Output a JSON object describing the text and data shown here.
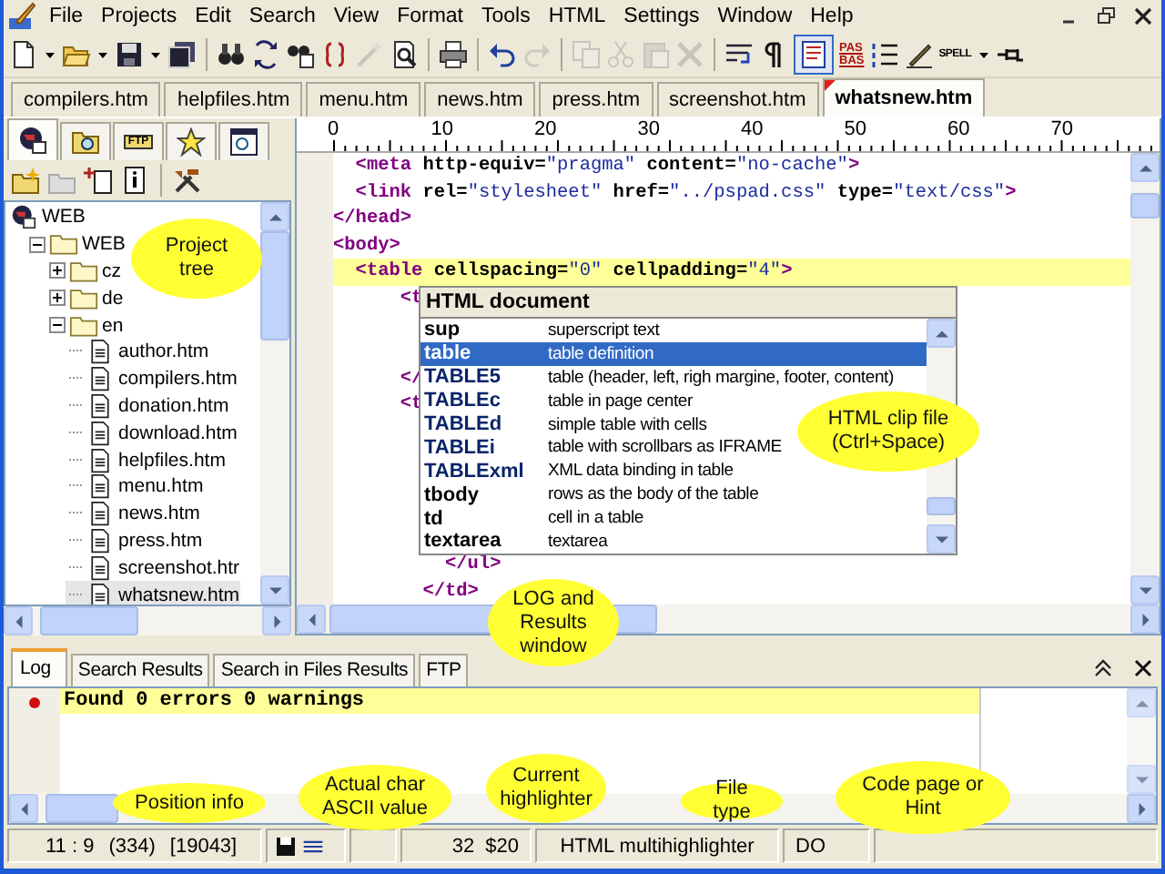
{
  "menu": [
    "File",
    "Projects",
    "Edit",
    "Search",
    "View",
    "Format",
    "Tools",
    "HTML",
    "Settings",
    "Window",
    "Help"
  ],
  "toolbar": [
    {
      "kind": "new",
      "disabled": false
    },
    {
      "kind": "dropdown",
      "disabled": false
    },
    {
      "kind": "open",
      "disabled": false
    },
    {
      "kind": "dropdown",
      "disabled": false
    },
    {
      "kind": "save",
      "disabled": false
    },
    {
      "kind": "dropdown",
      "disabled": false
    },
    {
      "kind": "saveall",
      "disabled": false
    },
    {
      "kind": "separator"
    },
    {
      "kind": "find",
      "disabled": false
    },
    {
      "kind": "replace",
      "disabled": false
    },
    {
      "kind": "findfiles",
      "disabled": false
    },
    {
      "kind": "braces",
      "disabled": false
    },
    {
      "kind": "magic",
      "disabled": true
    },
    {
      "kind": "preview",
      "disabled": false
    },
    {
      "kind": "separator"
    },
    {
      "kind": "print",
      "disabled": false
    },
    {
      "kind": "separator"
    },
    {
      "kind": "undo",
      "disabled": false
    },
    {
      "kind": "redo",
      "disabled": true
    },
    {
      "kind": "separator"
    },
    {
      "kind": "copy",
      "disabled": true
    },
    {
      "kind": "cut",
      "disabled": true
    },
    {
      "kind": "paste",
      "disabled": true
    },
    {
      "kind": "delete",
      "disabled": true
    },
    {
      "kind": "separator"
    },
    {
      "kind": "wrap",
      "disabled": false
    },
    {
      "kind": "pilcrow",
      "disabled": false
    },
    {
      "kind": "toggle",
      "on": true
    },
    {
      "kind": "case",
      "lines": [
        "PAS",
        "BAS"
      ]
    },
    {
      "kind": "list",
      "disabled": false
    },
    {
      "kind": "pencil",
      "disabled": false
    },
    {
      "kind": "spell",
      "text": "SPELL"
    },
    {
      "kind": "dropdown",
      "disabled": false
    },
    {
      "kind": "pin",
      "disabled": false
    }
  ],
  "file_tabs": [
    {
      "label": "compilers.htm",
      "selected": false,
      "modified": false
    },
    {
      "label": "helpfiles.htm",
      "selected": false,
      "modified": false
    },
    {
      "label": "menu.htm",
      "selected": false,
      "modified": false
    },
    {
      "label": "news.htm",
      "selected": false,
      "modified": false
    },
    {
      "label": "press.htm",
      "selected": false,
      "modified": false
    },
    {
      "label": "screenshot.htm",
      "selected": false,
      "modified": false
    },
    {
      "label": "whatsnew.htm",
      "selected": true,
      "modified": true
    }
  ],
  "side_tabs": [
    {
      "kind": "project",
      "selected": true
    },
    {
      "kind": "find",
      "selected": false
    },
    {
      "kind": "ftp",
      "label": "FTP",
      "selected": false
    },
    {
      "kind": "favorites",
      "selected": false
    },
    {
      "kind": "search",
      "selected": false
    }
  ],
  "tree": [
    {
      "label": "WEB",
      "kind": "root",
      "children": [
        {
          "label": "WEB",
          "kind": "folder",
          "expanded": true,
          "children": [
            {
              "label": "cz",
              "kind": "folder",
              "expanded": false
            },
            {
              "label": "de",
              "kind": "folder",
              "expanded": false
            },
            {
              "label": "en",
              "kind": "folder",
              "expanded": true,
              "children": [
                {
                  "label": "author.htm",
                  "kind": "file",
                  "selected": false
                },
                {
                  "label": "compilers.htm",
                  "kind": "file",
                  "selected": false
                },
                {
                  "label": "donation.htm",
                  "kind": "file",
                  "selected": false
                },
                {
                  "label": "download.htm",
                  "kind": "file",
                  "selected": false
                },
                {
                  "label": "helpfiles.htm",
                  "kind": "file",
                  "selected": false
                },
                {
                  "label": "menu.htm",
                  "kind": "file",
                  "selected": false
                },
                {
                  "label": "news.htm",
                  "kind": "file",
                  "selected": false
                },
                {
                  "label": "press.htm",
                  "kind": "file",
                  "selected": false
                },
                {
                  "label": "screenshot.htr",
                  "kind": "file",
                  "selected": false
                },
                {
                  "label": "whatsnew.htm",
                  "kind": "file",
                  "selected": true
                }
              ]
            }
          ]
        }
      ]
    }
  ],
  "ruler": [
    "0",
    "10",
    "20",
    "30",
    "40",
    "50",
    "60",
    "70"
  ],
  "editor": {
    "lines": [
      {
        "kind": "code",
        "highlighted": false,
        "segs": [
          {
            "kind": "tag",
            "t": "  <meta"
          },
          {
            "kind": "attr",
            "t": " http-equiv="
          },
          {
            "kind": "val",
            "t": "\"pragma\""
          },
          {
            "kind": "attr",
            "t": " content="
          },
          {
            "kind": "val",
            "t": "\"no-cache\""
          },
          {
            "kind": "tag",
            "t": ">"
          }
        ]
      },
      {
        "kind": "code",
        "highlighted": false,
        "segs": [
          {
            "kind": "tag",
            "t": "  <link"
          },
          {
            "kind": "attr",
            "t": " rel="
          },
          {
            "kind": "val",
            "t": "\"stylesheet\""
          },
          {
            "kind": "attr",
            "t": " href="
          },
          {
            "kind": "val",
            "t": "\"../pspad.css\""
          },
          {
            "kind": "attr",
            "t": " type="
          },
          {
            "kind": "val",
            "t": "\"text/css\""
          },
          {
            "kind": "tag",
            "t": ">"
          }
        ]
      },
      {
        "kind": "code",
        "highlighted": false,
        "segs": [
          {
            "kind": "tag",
            "t": "</head>"
          }
        ]
      },
      {
        "kind": "code",
        "highlighted": false,
        "segs": [
          {
            "kind": "tag",
            "t": "<body>"
          }
        ]
      },
      {
        "kind": "code",
        "highlighted": true,
        "segs": [
          {
            "kind": "tag",
            "t": "  <table"
          },
          {
            "kind": "attr",
            "t": " cellspacing="
          },
          {
            "kind": "val",
            "t": "\"0\""
          },
          {
            "kind": "attr",
            "t": " cellpadding="
          },
          {
            "kind": "val",
            "t": "\"4\""
          },
          {
            "kind": "tag",
            "t": ">"
          }
        ]
      },
      {
        "kind": "code",
        "highlighted": false,
        "segs": [
          {
            "kind": "tag",
            "t": "      <t"
          }
        ]
      },
      {
        "kind": "covered"
      },
      {
        "kind": "covered"
      },
      {
        "kind": "code",
        "highlighted": false,
        "segs": [
          {
            "kind": "tag",
            "t": "      </"
          }
        ]
      },
      {
        "kind": "code",
        "highlighted": false,
        "segs": [
          {
            "kind": "tag",
            "t": "      <t"
          }
        ]
      },
      {
        "kind": "covered"
      },
      {
        "kind": "covered"
      },
      {
        "kind": "covered"
      },
      {
        "kind": "covered"
      },
      {
        "kind": "covered"
      },
      {
        "kind": "code",
        "highlighted": false,
        "segs": [
          {
            "kind": "tag",
            "t": "          </ul>"
          }
        ]
      },
      {
        "kind": "code",
        "highlighted": false,
        "segs": [
          {
            "kind": "tag",
            "t": "        </td>"
          }
        ]
      }
    ],
    "completion": {
      "title": "HTML document",
      "items": [
        {
          "kind": "tag",
          "name": "sup",
          "description": "superscript text",
          "selected": false
        },
        {
          "kind": "tag",
          "name": "table",
          "description": "table definition",
          "selected": true
        },
        {
          "kind": "clip",
          "name": "TABLE5",
          "description": "table (header, left, righ margine, footer, content)",
          "selected": false
        },
        {
          "kind": "clip",
          "name": "TABLEc",
          "description": "table in page center",
          "selected": false
        },
        {
          "kind": "clip",
          "name": "TABLEd",
          "description": "simple table with cells",
          "selected": false
        },
        {
          "kind": "clip",
          "name": "TABLEi",
          "description": "table with scrollbars as IFRAME",
          "selected": false
        },
        {
          "kind": "clip",
          "name": "TABLExml",
          "description": "XML data binding in table",
          "selected": false
        },
        {
          "kind": "tag",
          "name": "tbody",
          "description": "rows as the body of the table",
          "selected": false
        },
        {
          "kind": "tag",
          "name": "td",
          "description": "cell in a table",
          "selected": false
        },
        {
          "kind": "tag",
          "name": "textarea",
          "description": "textarea",
          "selected": false
        }
      ]
    }
  },
  "results": {
    "tabs": [
      {
        "label": "Log",
        "selected": true
      },
      {
        "label": "Search Results",
        "selected": false
      },
      {
        "label": "Search in Files Results",
        "selected": false
      },
      {
        "label": "FTP",
        "selected": false
      }
    ],
    "log": [
      {
        "text": "Found 0 errors 0 warnings",
        "highlighted": true
      }
    ]
  },
  "status_bar": {
    "position": "11 : 9",
    "offset": "(334)",
    "size": "[19043]",
    "char_code": "32",
    "char_hex": "$20",
    "highlighter": "HTML multihighlighter",
    "file_type": "DO"
  },
  "callouts": [
    "Project tree",
    "HTML clip file (Ctrl+Space)",
    "LOG and Results window",
    "Position info",
    "Actual char ASCII value",
    "Current highlighter",
    "File type",
    "Code page or Hint"
  ]
}
